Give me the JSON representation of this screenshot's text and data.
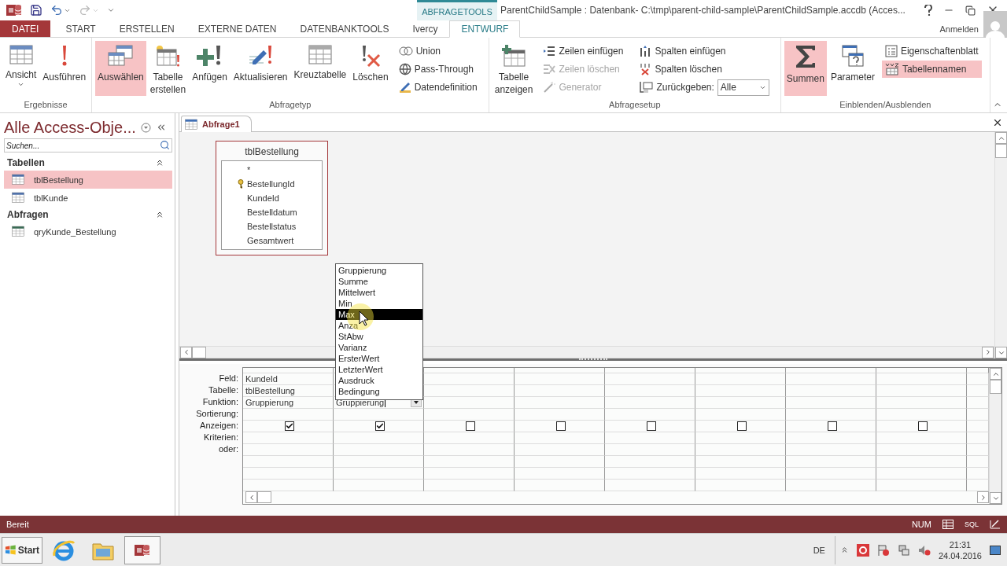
{
  "window": {
    "title": "ParentChildSample : Datenbank- C:\\tmp\\parent-child-sample\\ParentChildSample.accdb (Acces...",
    "context_tab": "ABFRAGETOOLS",
    "account": "Anmelden"
  },
  "ribbon_tabs": [
    {
      "label": "DATEI",
      "kind": "file",
      "selected": false
    },
    {
      "label": "START",
      "kind": "tab",
      "selected": false
    },
    {
      "label": "ERSTELLEN",
      "kind": "tab",
      "selected": false
    },
    {
      "label": "EXTERNE DATEN",
      "kind": "tab",
      "selected": false
    },
    {
      "label": "DATENBANKTOOLS",
      "kind": "tab",
      "selected": false
    },
    {
      "label": "Ivercy",
      "kind": "tab",
      "selected": false
    },
    {
      "label": "ENTWURF",
      "kind": "tab",
      "selected": true
    }
  ],
  "ribbon_groups": [
    {
      "label": "Ergebnisse",
      "columns": [
        {
          "kind": "large",
          "label": "Ansicht",
          "menu": true,
          "selected": false
        },
        {
          "kind": "large",
          "label": "Ausführen",
          "menu": false,
          "selected": false
        }
      ]
    },
    {
      "label": "Abfragetyp",
      "columns": [
        {
          "kind": "large",
          "label": "Auswählen",
          "menu": false,
          "selected": true
        },
        {
          "kind": "large",
          "label": "Tabelle erstellen",
          "menu": false,
          "selected": false
        },
        {
          "kind": "large",
          "label": "Anfügen",
          "menu": false,
          "selected": false
        },
        {
          "kind": "large",
          "label": "Aktualisieren",
          "menu": false,
          "selected": false
        },
        {
          "kind": "large",
          "label": "Kreuztabelle",
          "menu": false,
          "selected": false
        },
        {
          "kind": "large",
          "label": "Löschen",
          "menu": false,
          "selected": false
        },
        {
          "kind": "stack",
          "items": [
            {
              "kind": "button",
              "label": "Union",
              "selected": false,
              "disabled": false
            },
            {
              "kind": "button",
              "label": "Pass-Through",
              "selected": false,
              "disabled": false
            },
            {
              "kind": "button",
              "label": "Datendefinition",
              "selected": false,
              "disabled": false
            }
          ]
        }
      ]
    },
    {
      "label": "Abfragesetup",
      "columns": [
        {
          "kind": "large",
          "label": "Tabelle anzeigen",
          "menu": false,
          "selected": false
        },
        {
          "kind": "stack",
          "items": [
            {
              "kind": "button",
              "label": "Zeilen einfügen",
              "selected": false,
              "disabled": false
            },
            {
              "kind": "button",
              "label": "Zeilen löschen",
              "selected": false,
              "disabled": true
            },
            {
              "kind": "button",
              "label": "Generator",
              "selected": false,
              "disabled": true
            }
          ]
        },
        {
          "kind": "stack",
          "items": [
            {
              "kind": "button",
              "label": "Spalten einfügen",
              "selected": false,
              "disabled": false
            },
            {
              "kind": "button",
              "label": "Spalten löschen",
              "selected": false,
              "disabled": false
            },
            {
              "kind": "combo",
              "label": "Zurückgeben:",
              "value": "Alle"
            }
          ]
        }
      ]
    },
    {
      "label": "Einblenden/Ausblenden",
      "columns": [
        {
          "kind": "large",
          "label": "Summen",
          "menu": false,
          "selected": true
        },
        {
          "kind": "large",
          "label": "Parameter",
          "menu": false,
          "selected": false
        },
        {
          "kind": "stack",
          "items": [
            {
              "kind": "button",
              "label": "Eigenschaftenblatt",
              "selected": false,
              "disabled": false
            },
            {
              "kind": "button",
              "label": "Tabellennamen",
              "selected": true,
              "disabled": false
            }
          ]
        }
      ]
    }
  ],
  "navigation": {
    "title": "Alle Access-Obje...",
    "search": {
      "placeholder": "Suchen..."
    },
    "sections": [
      {
        "label": "Tabellen",
        "expanded": true,
        "items": [
          {
            "label": "tblBestellung",
            "kind": "table",
            "selected": true
          },
          {
            "label": "tblKunde",
            "kind": "table",
            "selected": false
          }
        ]
      },
      {
        "label": "Abfragen",
        "expanded": true,
        "items": [
          {
            "label": "qryKunde_Bestellung",
            "kind": "query",
            "selected": false
          }
        ]
      }
    ]
  },
  "document_tabs": [
    {
      "label": "Abfrage1",
      "selected": true
    }
  ],
  "table_box": {
    "title": "tblBestellung",
    "fields": [
      {
        "name": "*",
        "key": false
      },
      {
        "name": "BestellungId",
        "key": true
      },
      {
        "name": "KundeId",
        "key": false
      },
      {
        "name": "Bestelldatum",
        "key": false
      },
      {
        "name": "Bestellstatus",
        "key": false
      },
      {
        "name": "Gesamtwert",
        "key": false
      }
    ]
  },
  "design_grid": {
    "row_labels": [
      "Feld:",
      "Tabelle:",
      "Funktion:",
      "Sortierung:",
      "Anzeigen:",
      "Kriterien:",
      "oder:"
    ],
    "columns": [
      {
        "field": "KundeId",
        "table": "tblBestellung",
        "function": "Gruppierung",
        "show": true,
        "editing": false
      },
      {
        "function": "Gruppierung",
        "show": true,
        "editing": true
      },
      {
        "show": false
      },
      {
        "show": false
      },
      {
        "show": false
      },
      {
        "show": false
      },
      {
        "show": false
      },
      {
        "show": false
      }
    ]
  },
  "function_dropdown": {
    "items": [
      {
        "label": "Gruppierung",
        "selected": false
      },
      {
        "label": "Summe",
        "selected": false
      },
      {
        "label": "Mittelwert",
        "selected": false
      },
      {
        "label": "Min",
        "selected": false
      },
      {
        "label": "Max",
        "selected": true
      },
      {
        "label": "Anza",
        "selected": false
      },
      {
        "label": "StAbw",
        "selected": false
      },
      {
        "label": "Varianz",
        "selected": false
      },
      {
        "label": "ErsterWert",
        "selected": false
      },
      {
        "label": "LetzterWert",
        "selected": false
      },
      {
        "label": "Ausdruck",
        "selected": false
      },
      {
        "label": "Bedingung",
        "selected": false
      }
    ]
  },
  "status_bar": {
    "text": "Bereit",
    "indicator": "NUM",
    "view_label": "SQL"
  },
  "taskbar": {
    "start": "Start",
    "language": "DE",
    "time": "21:31",
    "date": "24.04.2016"
  }
}
